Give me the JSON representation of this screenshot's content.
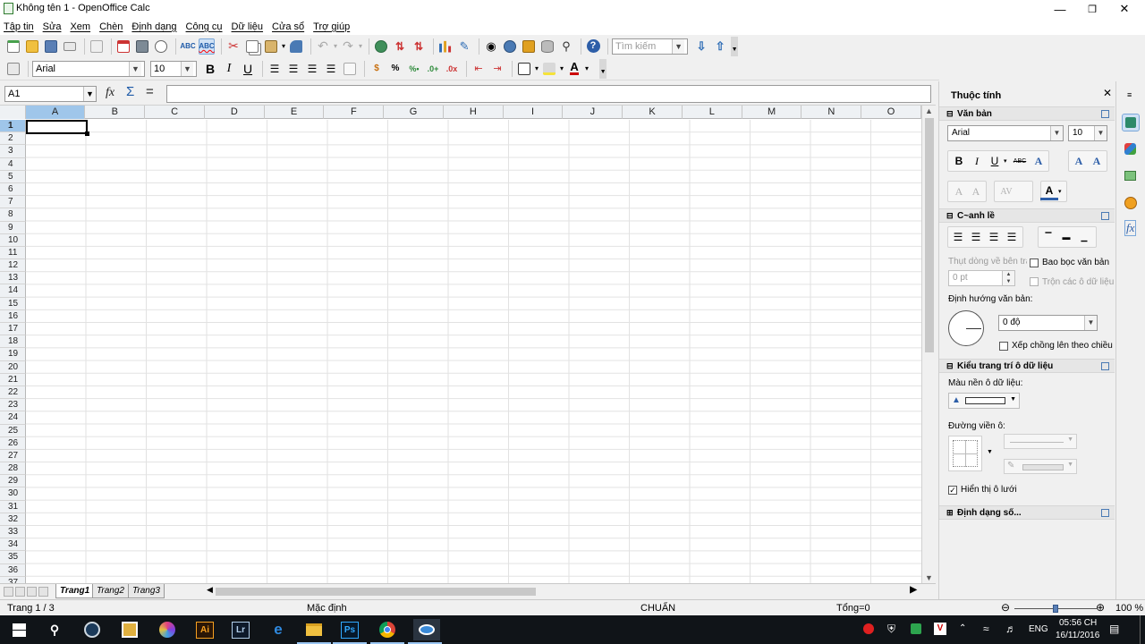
{
  "window": {
    "title": "Không tên 1 - OpenOffice Calc",
    "min_icon": "minimize-icon",
    "max_icon": "maximize-icon",
    "close_icon": "close-icon"
  },
  "menu": [
    "Tập tin",
    "Sửa",
    "Xem",
    "Chèn",
    "Định dạng",
    "Công cụ",
    "Dữ liệu",
    "Cửa sổ",
    "Trợ giúp"
  ],
  "toolbar": {
    "standard_icons": [
      "new-icon",
      "open-icon",
      "save-icon",
      "email-icon",
      "edit-file-icon",
      "export-pdf-icon",
      "print-icon",
      "print-preview-icon",
      "spellcheck-icon",
      "autospellcheck-icon",
      "cut-icon",
      "copy-icon",
      "paste-icon",
      "clone-format-icon",
      "undo-icon",
      "redo-icon",
      "hyperlink-icon",
      "sort-ascending-icon",
      "sort-descending-icon",
      "chart-icon",
      "draw-functions-icon",
      "find-replace-icon",
      "navigator-icon",
      "gallery-icon",
      "data-sources-icon",
      "zoom-icon",
      "help-icon"
    ],
    "search_placeholder": "Tìm kiếm",
    "font_name": "Arial",
    "font_size": "10",
    "bold": "B",
    "italic": "I",
    "underline": "U"
  },
  "formula_bar": {
    "cell_ref": "A1",
    "formula": ""
  },
  "grid": {
    "columns": [
      "A",
      "B",
      "C",
      "D",
      "E",
      "F",
      "G",
      "H",
      "I",
      "J",
      "K",
      "L",
      "M",
      "N",
      "O"
    ],
    "rows": [
      "1",
      "2",
      "3",
      "4",
      "5",
      "6",
      "7",
      "8",
      "9",
      "10",
      "11",
      "12",
      "13",
      "14",
      "15",
      "16",
      "17",
      "18",
      "19",
      "20",
      "21",
      "22",
      "23",
      "24",
      "25",
      "26",
      "27",
      "28",
      "29",
      "30",
      "31",
      "32",
      "33",
      "34",
      "35",
      "36",
      "37"
    ],
    "selected_cell": "A1"
  },
  "sheets": [
    "Trang1",
    "Trang2",
    "Trang3"
  ],
  "active_sheet": "Trang1",
  "status": {
    "page": "Trang 1 / 3",
    "style": "Mặc định",
    "mode": "CHUẨN",
    "sum": "Tổng=0",
    "zoom": "100 %",
    "zoom_level": 100
  },
  "sidebar": {
    "title": "Thuộc tính",
    "text_section": "Văn bản",
    "font_name": "Arial",
    "font_size": "10",
    "align_section": "C~anh lề",
    "indent_label": "Thụt dòng về bên trái:",
    "indent_value": "0 pt",
    "wrap_text": "Bao bọc văn bản",
    "merge_cells": "Trộn các ô dữ liệu",
    "orientation_label": "Định hướng văn bản:",
    "orientation_value": "0 độ",
    "stack_vertical": "Xếp chồng lên theo chiều",
    "cell_format_section": "Kiểu trang trí ô dữ liệu",
    "bg_color_label": "Màu nền ô dữ liệu:",
    "border_label": "Đường viền ô:",
    "show_grid": "Hiển thị ô lưới",
    "show_grid_checked": true,
    "number_format_section": "Định dạng số..."
  },
  "taskbar": {
    "apps": [
      "windows-start-icon",
      "search-icon",
      "steam-icon",
      "file-manager-icon",
      "colorful-app-icon",
      "illustrator-icon",
      "lightroom-icon",
      "edge-icon",
      "explorer-icon",
      "photoshop-icon",
      "chrome-icon",
      "openoffice-icon"
    ],
    "ai": "Ai",
    "lr": "Lr",
    "ps": "Ps",
    "lang": "ENG",
    "time": "05:56 CH",
    "date": "16/11/2016"
  },
  "colors": {
    "accent": "#1e5aa8",
    "selection": "#9fc6ea",
    "taskbar": "#101418"
  }
}
